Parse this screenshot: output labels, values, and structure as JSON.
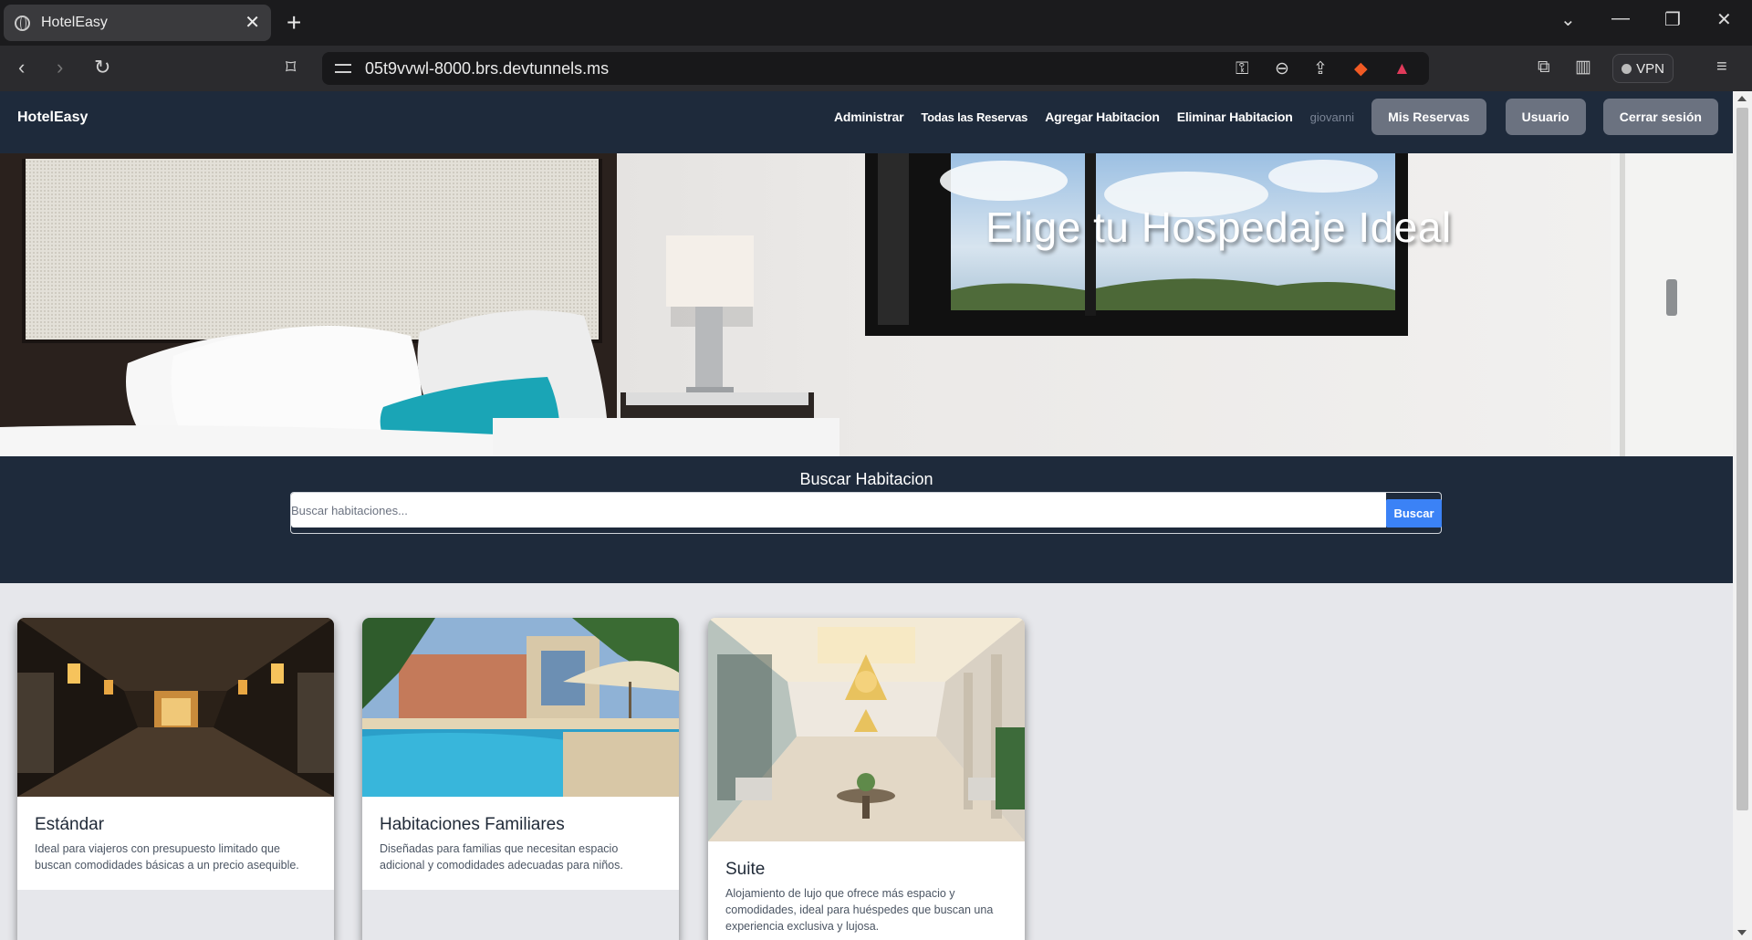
{
  "browser": {
    "tab_title": "HotelEasy",
    "url": "05t9vvwl-8000.brs.devtunnels.ms",
    "vpn_label": "VPN"
  },
  "site": {
    "brand": "HotelEasy",
    "nav": {
      "links": [
        "Administrar",
        "Todas las Reservas",
        "Agregar Habitacion",
        "Eliminar Habitacion"
      ],
      "username": "giovanni",
      "buttons": [
        "Mis Reservas",
        "Usuario",
        "Cerrar sesión"
      ]
    },
    "hero": {
      "headline": "Elige tu Hospedaje Ideal"
    },
    "search": {
      "title": "Buscar Habitacion",
      "placeholder": "Buscar habitaciones...",
      "button": "Buscar"
    },
    "rooms": [
      {
        "title": "Estándar",
        "description": "Ideal para viajeros con presupuesto limitado que buscan comodidades básicas a un precio asequible."
      },
      {
        "title": "Habitaciones Familiares",
        "description": "Diseñadas para familias que necesitan espacio adicional y comodidades adecuadas para niños."
      },
      {
        "title": "Suite",
        "description": "Alojamiento de lujo que ofrece más espacio y comodidades, ideal para huéspedes que buscan una experiencia exclusiva y lujosa."
      }
    ]
  },
  "colors": {
    "nav_bg": "#1e2a3b",
    "pill_button": "#6b7280",
    "search_button": "#3b82f6",
    "page_bg": "#e6e7eb"
  }
}
